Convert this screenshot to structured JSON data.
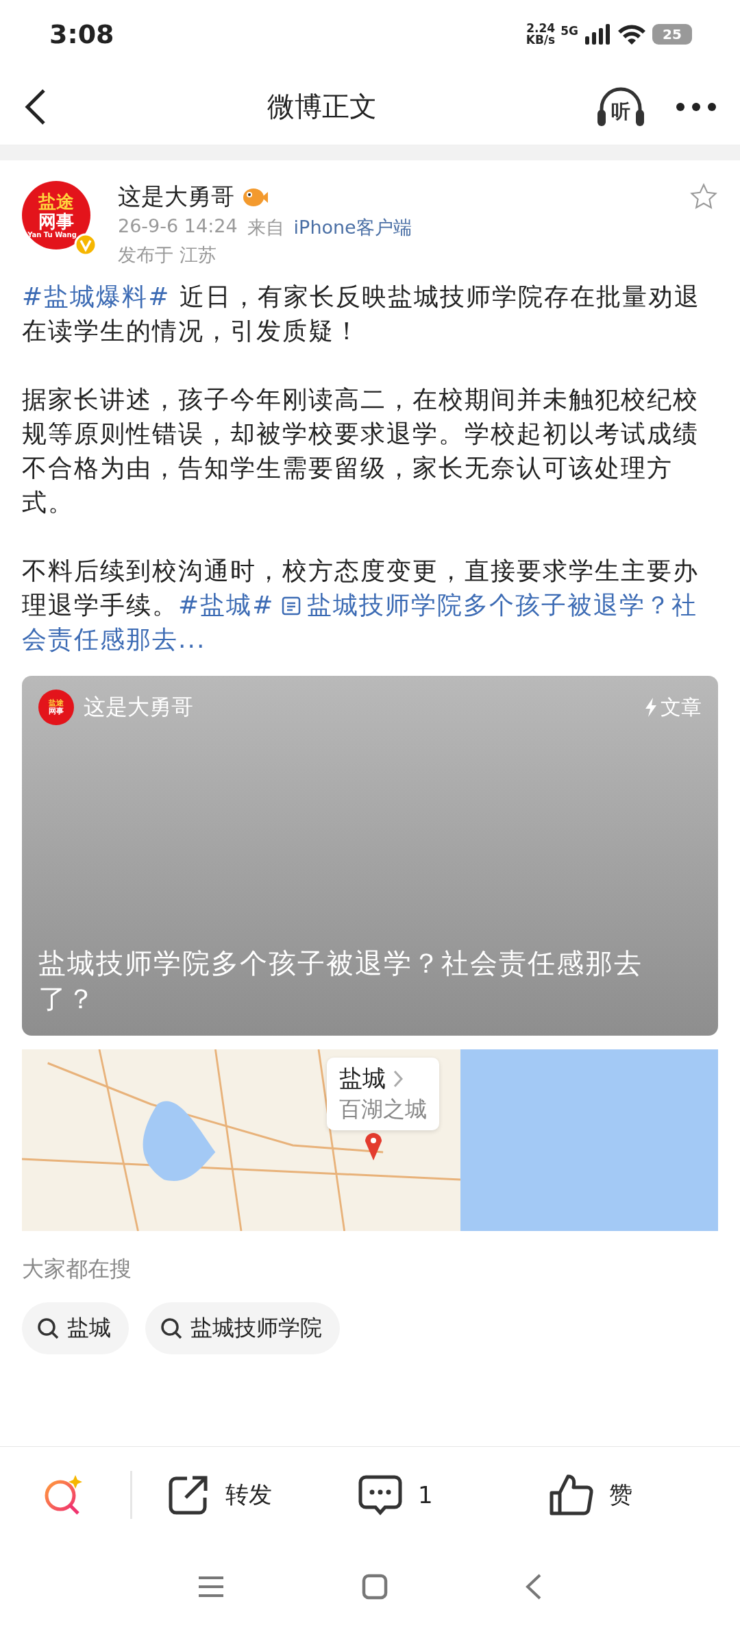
{
  "status_bar": {
    "time": "3:08",
    "speed": "2.24",
    "speed_unit": "KB/s",
    "network": "5G",
    "battery": "25"
  },
  "header": {
    "title": "微博正文",
    "listen_label": "听"
  },
  "post": {
    "author": "这是大勇哥",
    "avatar_lines": [
      "盐途",
      "网事"
    ],
    "avatar_caption": "Yan Tu Wang",
    "verified": true,
    "favorited": false,
    "time": "26-9-6 14:24",
    "source_prefix": "来自",
    "source": "iPhone客户端",
    "location": "发布于 江苏",
    "paragraphs": [
      [
        {
          "kind": "topic",
          "text": "#盐城爆料#"
        },
        {
          "kind": "text",
          "text": " 近日，有家长反映盐城技师学院存在批量劝退在读学生的情况，引发质疑！"
        }
      ],
      [
        {
          "kind": "text",
          "text": "据家长讲述，孩子今年刚读高二，在校期间并未触犯校纪校规等原则性错误，却被学校要求退学。学校起初以考试成绩不合格为由，告知学生需要留级，家长无奈认可该处理方式。"
        }
      ],
      [
        {
          "kind": "text",
          "text": "不料后续到校沟通时，校方态度变更，直接要求学生主要办理退学手续。"
        },
        {
          "kind": "topic",
          "text": "#盐城#"
        },
        {
          "kind": "article_link",
          "text": "盐城技师学院多个孩子被退学？社"
        },
        {
          "kind": "link",
          "text": "会责任感那去..."
        }
      ]
    ]
  },
  "article_card": {
    "author": "这是大勇哥",
    "avatar_lines": [
      "盐途",
      "网事"
    ],
    "badge": "文章",
    "title": "盐城技师学院多个孩子被退学？社会责任感那去了？"
  },
  "map_card": {
    "city": "盐城",
    "subtitle": "百湖之城"
  },
  "hot_search": {
    "title": "大家都在搜",
    "items": [
      "盐城",
      "盐城技师学院"
    ]
  },
  "action_bar": {
    "repost": "转发",
    "comments": "1",
    "like": "赞"
  }
}
